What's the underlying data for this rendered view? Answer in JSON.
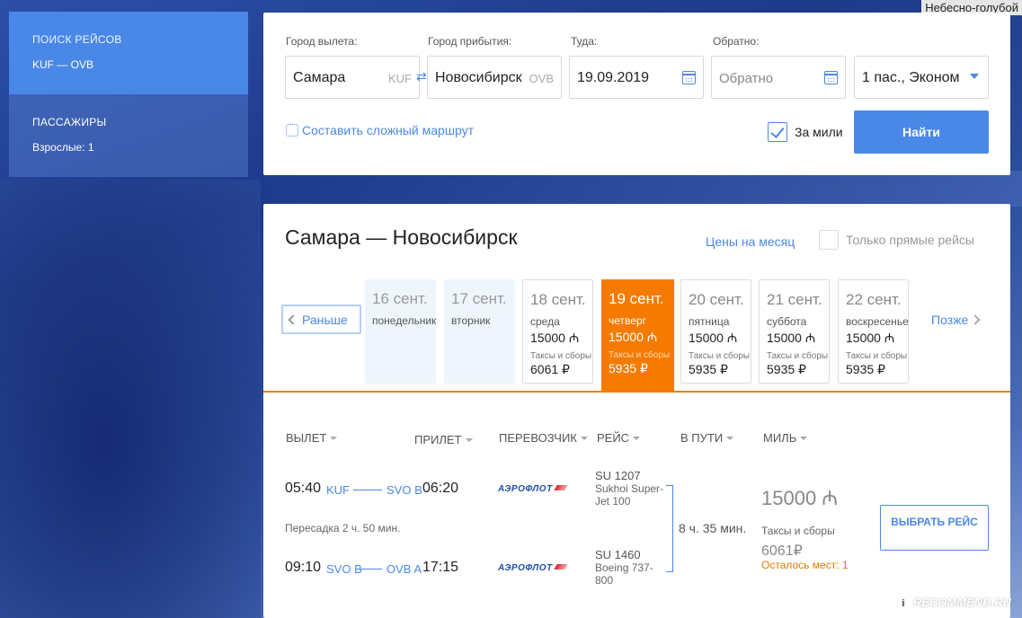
{
  "watermark_top": "Небесно-голубой",
  "sidebar": {
    "search_title": "ПОИСК РЕЙСОВ",
    "search_route": "KUF — OVB",
    "passengers_title": "ПАССАЖИРЫ",
    "passengers_value": "Взрослые: 1"
  },
  "search": {
    "from_label": "Город вылета:",
    "from_value": "Самара",
    "from_code": "KUF",
    "to_label": "Город прибытия:",
    "to_value": "Новосибирск",
    "to_code": "OVB",
    "swap_icon": "⇄",
    "depart_label": "Туда:",
    "depart_value": "19.09.2019",
    "return_label": "Обратно:",
    "return_placeholder": "Обратно",
    "passengers_value": "1 пас., Эконом",
    "complex_route": "Составить сложный маршрут",
    "miles_label": "За мили",
    "miles_checked": true,
    "find_button": "Найти"
  },
  "results": {
    "route_title": "Самара — Новосибирск",
    "month_prices": "Цены на месяц",
    "direct_only": "Только прямые рейсы",
    "earlier": "Раньше",
    "later": "Позже",
    "days": [
      {
        "date": "16 сент.",
        "weekday": "понедельник",
        "price": "",
        "tax_label": "",
        "fee": "",
        "state": "past"
      },
      {
        "date": "17 сент.",
        "weekday": "вторник",
        "price": "",
        "tax_label": "",
        "fee": "",
        "state": "past"
      },
      {
        "date": "18 сент.",
        "weekday": "среда",
        "price": "15000 ₼",
        "tax_label": "Таксы и сборы",
        "fee": "6061 ₽",
        "state": "normal"
      },
      {
        "date": "19 сент.",
        "weekday": "четверг",
        "price": "15000 ₼",
        "tax_label": "Таксы и сборы",
        "fee": "5935 ₽",
        "state": "selected"
      },
      {
        "date": "20 сент.",
        "weekday": "пятница",
        "price": "15000 ₼",
        "tax_label": "Таксы и сборы",
        "fee": "5935 ₽",
        "state": "normal"
      },
      {
        "date": "21 сент.",
        "weekday": "суббота",
        "price": "15000 ₼",
        "tax_label": "Таксы и сборы",
        "fee": "5935 ₽",
        "state": "normal"
      },
      {
        "date": "22 сент.",
        "weekday": "воскресенье",
        "price": "15000 ₼",
        "tax_label": "Таксы и сборы",
        "fee": "5935 ₽",
        "state": "normal"
      }
    ],
    "columns": {
      "depart": "ВЫЛЕТ",
      "arrive": "ПРИЛЕТ",
      "carrier": "ПЕРЕВОЗЧИК",
      "flight": "РЕЙС",
      "duration": "В ПУТИ",
      "miles": "МИЛЬ"
    },
    "offer": {
      "segments": [
        {
          "dep_time": "05:40",
          "dep_apt": "KUF",
          "arr_apt": "SVO B",
          "arr_time": "06:20",
          "carrier": "АЭРОФЛОТ",
          "flight_no": "SU 1207",
          "aircraft": "Sukhoi Super-Jet 100"
        },
        {
          "dep_time": "09:10",
          "dep_apt": "SVO B",
          "arr_apt": "OVB A",
          "arr_time": "17:15",
          "carrier": "АЭРОФЛОТ",
          "flight_no": "SU 1460",
          "aircraft": "Boeing 737-800"
        }
      ],
      "transfer": "Пересадка 2 ч. 50 мин.",
      "duration": "8 ч. 35 мин.",
      "miles": "15000 ₼",
      "tax_label": "Таксы и сборы",
      "fee": "6061₽",
      "seats_left": "Осталось мест: 1",
      "select_button": "ВЫБРАТЬ РЕЙС"
    }
  },
  "watermark_bottom": "RECOMMEND.RU",
  "colors": {
    "accent": "#4a88e8",
    "selected_day": "#f47b00",
    "warning": "#e07b00"
  }
}
